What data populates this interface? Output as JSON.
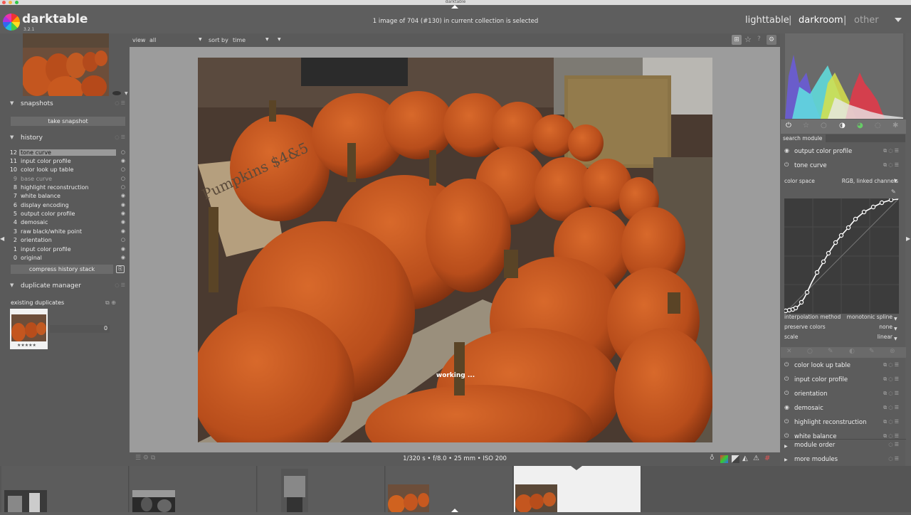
{
  "window": {
    "title": "darktable"
  },
  "app": {
    "name": "darktable",
    "version": "3.2.1"
  },
  "header": {
    "selection_info": "1 image of 704 (#130) in current collection is selected",
    "views": [
      "lighttable",
      "darkroom",
      "other"
    ],
    "separator": "|",
    "active_view": "darkroom",
    "dropdown_icon": "triangle-down"
  },
  "toolbar": {
    "view_label": "view",
    "view_value": "all",
    "sort_label": "sort by",
    "sort_value": "time"
  },
  "snapshots": {
    "title": "snapshots",
    "take_snapshot": "take snapshot"
  },
  "history": {
    "title": "history",
    "items": [
      {
        "num": "12",
        "name": "tone curve",
        "state": "active"
      },
      {
        "num": "11",
        "name": "input color profile",
        "state": "on"
      },
      {
        "num": "10",
        "name": "color look up table",
        "state": "on"
      },
      {
        "num": "9",
        "name": "base curve",
        "state": "disabled"
      },
      {
        "num": "8",
        "name": "highlight reconstruction",
        "state": "on"
      },
      {
        "num": "7",
        "name": "white balance",
        "state": "on"
      },
      {
        "num": "6",
        "name": "display encoding",
        "state": "on"
      },
      {
        "num": "5",
        "name": "output color profile",
        "state": "on"
      },
      {
        "num": "4",
        "name": "demosaic",
        "state": "on"
      },
      {
        "num": "3",
        "name": "raw black/white point",
        "state": "on"
      },
      {
        "num": "2",
        "name": "orientation",
        "state": "on"
      },
      {
        "num": "1",
        "name": "input color profile",
        "state": "on"
      },
      {
        "num": "0",
        "name": "original",
        "state": "on"
      }
    ],
    "compress": "compress history stack"
  },
  "duplicate_manager": {
    "title": "duplicate manager",
    "existing": "existing duplicates",
    "count": "0",
    "stars": "★★★★★"
  },
  "center": {
    "working": "working ...",
    "exif": "1/320 s • f/8.0 • 25 mm • ISO 200",
    "photo_sign": "Pumpkins $4&5"
  },
  "right_panel": {
    "search_label": "search module",
    "modules_top": [
      "output color profile",
      "tone curve"
    ],
    "tone_curve": {
      "color_space_label": "color space",
      "color_space_value": "RGB, linked channels",
      "interpolation_label": "interpolation method",
      "interpolation_value": "monotonic spline",
      "preserve_label": "preserve colors",
      "preserve_value": "none",
      "scale_label": "scale",
      "scale_value": "linear"
    },
    "modules_bottom": [
      "color look up table",
      "input color profile",
      "orientation",
      "demosaic",
      "highlight reconstruction",
      "white balance"
    ],
    "module_order": "module order",
    "more_modules": "more modules"
  },
  "colors": {
    "accent": "#e0e0e0",
    "pumpkin": "#c0531f",
    "bg_panel": "#5a5a5a",
    "bg_center": "#9c9c9c"
  }
}
